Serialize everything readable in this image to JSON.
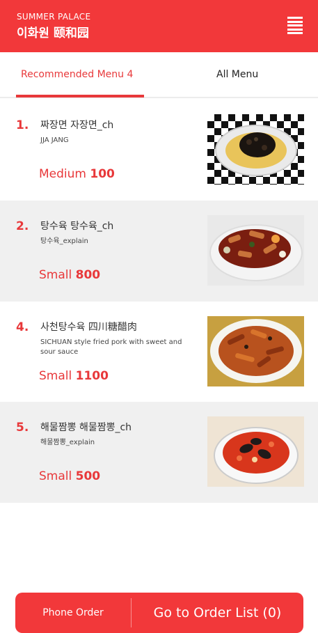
{
  "header": {
    "brand_en": "SUMMER PALACE",
    "brand_ko": "이화원 颐和园"
  },
  "tabs": {
    "recommended": "Recommended Menu 4",
    "all": "All Menu"
  },
  "items": [
    {
      "num": "1.",
      "name": "짜장면  자장면_ch",
      "desc": "JJA JANG",
      "size": "Medium",
      "price": "100"
    },
    {
      "num": "2.",
      "name": "탕수육  탕수육_ch",
      "desc": "탕수육_explain",
      "size": "Small",
      "price": "800"
    },
    {
      "num": "4.",
      "name": "사천탕수육  四川糖醋肉",
      "desc": "SICHUAN style fried pork with sweet and sour sauce",
      "size": "Small",
      "price": "1100"
    },
    {
      "num": "5.",
      "name": "해물짬뽕  해물짬뽕_ch",
      "desc": "해물짬뽕_explain",
      "size": "Small",
      "price": "500"
    }
  ],
  "order_bar": {
    "phone_order": "Phone Order",
    "go_to_order_list": "Go to Order List (0)"
  },
  "colors": {
    "accent": "#f2383a",
    "row_gray": "#f0f0f0"
  }
}
